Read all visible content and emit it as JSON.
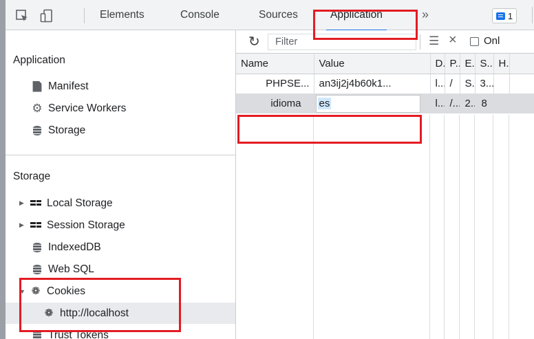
{
  "tabs": [
    "Elements",
    "Console",
    "Sources",
    "Application"
  ],
  "active_tab": "Application",
  "more_tabs": "»",
  "issues_count": "1",
  "sidebar": {
    "application_header": "Application",
    "application_items": [
      {
        "label": "Manifest",
        "icon": "document-icon"
      },
      {
        "label": "Service Workers",
        "icon": "gear-icon"
      },
      {
        "label": "Storage",
        "icon": "database-icon"
      }
    ],
    "storage_header": "Storage",
    "storage_items": [
      {
        "label": "Local Storage",
        "icon": "grid-icon",
        "expandable": true
      },
      {
        "label": "Session Storage",
        "icon": "grid-icon",
        "expandable": true
      },
      {
        "label": "IndexedDB",
        "icon": "database-icon"
      },
      {
        "label": "Web SQL",
        "icon": "database-icon"
      },
      {
        "label": "Cookies",
        "icon": "cookie-icon",
        "expanded": true
      },
      {
        "label": "http://localhost",
        "icon": "cookie-icon",
        "selected": true
      },
      {
        "label": "Trust Tokens",
        "icon": "database-icon"
      }
    ]
  },
  "toolbar": {
    "filter_placeholder": "Filter",
    "only_label": "Onl"
  },
  "cookies_table": {
    "columns": [
      "Name",
      "Value",
      "D.",
      "P..",
      "E.",
      "S..",
      "H."
    ],
    "rows": [
      [
        "PHPSE...",
        "an3ij2j4b60k1...",
        "l...",
        "/",
        "S...",
        "3...",
        ""
      ],
      [
        "idioma",
        "es",
        "l...",
        "/...",
        "2...",
        "8",
        ""
      ]
    ],
    "selected_row": 1
  },
  "colors": {
    "highlight": "#e31b23",
    "active_tab_underline": "#1a73e8"
  }
}
